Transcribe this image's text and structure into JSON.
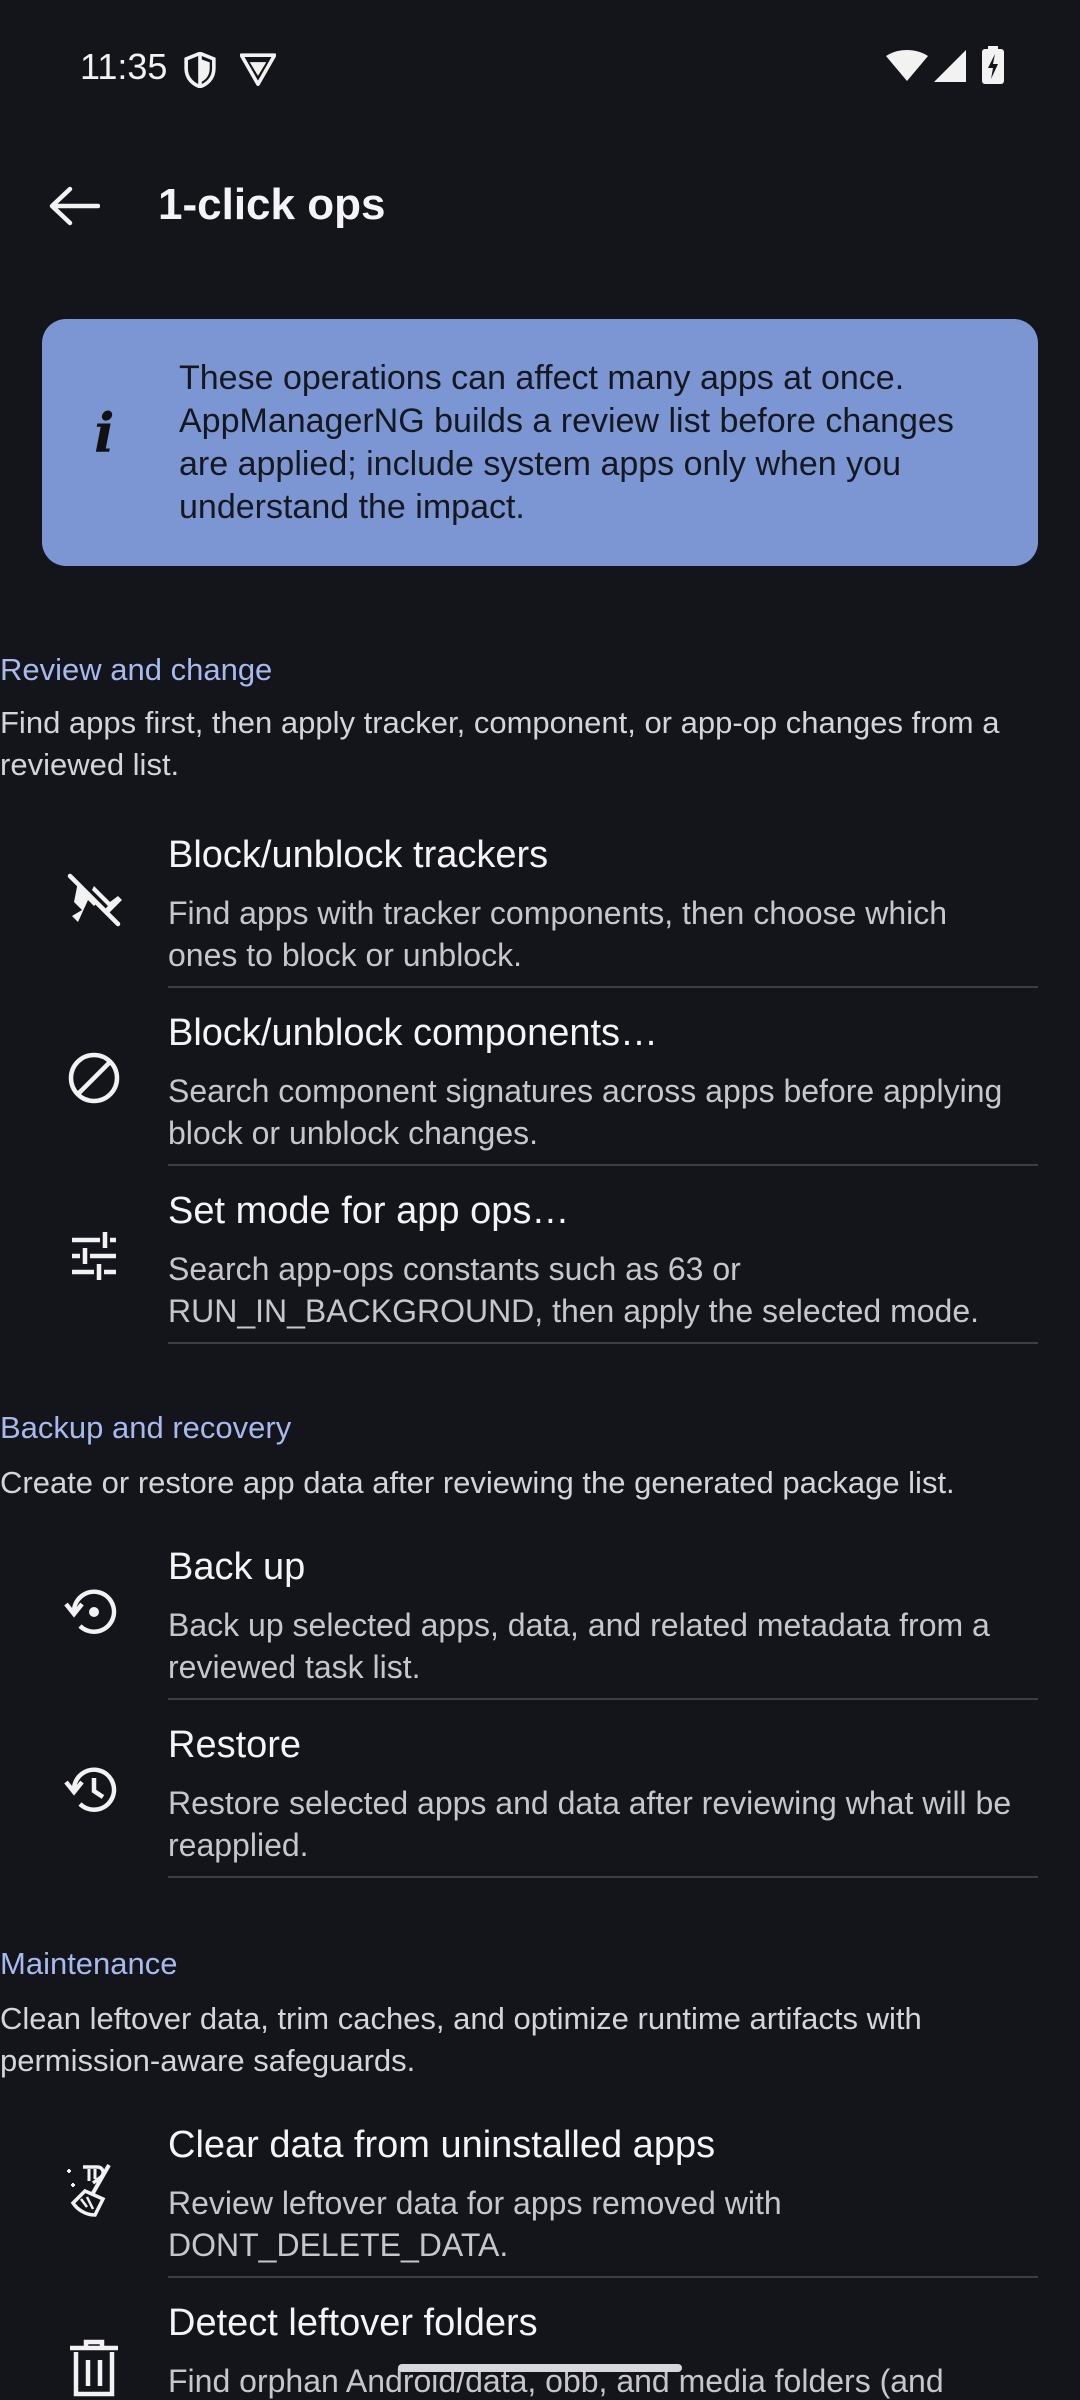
{
  "status_bar": {
    "time": "11:35",
    "icons": [
      "shield-icon",
      "vpn-icon",
      "wifi-icon",
      "signal-icon",
      "battery-charging-icon"
    ]
  },
  "app_bar": {
    "title": "1-click ops",
    "back_icon": "arrow-back-icon"
  },
  "info_card": {
    "icon": "info-icon",
    "icon_glyph": "i",
    "text": "These operations can affect many apps at once. AppManagerNG builds a review list before changes are applied; include system apps only when you understand the impact."
  },
  "sections": {
    "review": {
      "title": "Review and change",
      "description": "Find apps first, then apply tracker, component, or app-op changes from a reviewed list.",
      "items": [
        {
          "icon": "tracker-off-icon",
          "title": "Block/unblock trackers",
          "subtitle": "Find apps with tracker components, then choose which ones to block or unblock."
        },
        {
          "icon": "block-icon",
          "title": "Block/unblock components…",
          "subtitle": "Search component signatures across apps before applying block or unblock changes."
        },
        {
          "icon": "tune-icon",
          "title": "Set mode for app ops…",
          "subtitle": "Search app-ops constants such as 63 or RUN_IN_BACKGROUND, then apply the selected mode."
        }
      ]
    },
    "backup": {
      "title": "Backup and recovery",
      "description": "Create or restore app data after reviewing the generated package list.",
      "items": [
        {
          "icon": "backup-icon",
          "title": "Back up",
          "subtitle": "Back up selected apps, data, and related metadata from a reviewed task list."
        },
        {
          "icon": "restore-icon",
          "title": "Restore",
          "subtitle": "Restore selected apps and data after reviewing what will be reapplied."
        }
      ]
    },
    "maintenance": {
      "title": "Maintenance",
      "description": "Clean leftover data, trim caches, and optimize runtime artifacts with permission-aware safeguards.",
      "items": [
        {
          "icon": "cleaning-icon",
          "title": "Clear data from uninstalled apps",
          "subtitle": "Review leftover data for apps removed with DONT_DELETE_DATA."
        },
        {
          "icon": "trash-icon",
          "title": "Detect leftover folders",
          "subtitle": "Find orphan Android/data, obb, and media folders (and"
        }
      ]
    }
  },
  "colors": {
    "background": "#14151b",
    "info_card": "#7b96d3",
    "section_title": "#a7b9ee"
  }
}
